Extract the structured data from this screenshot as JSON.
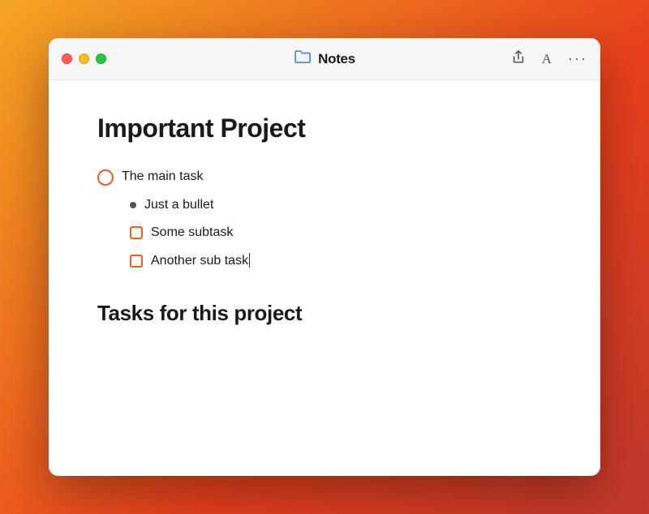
{
  "titlebar": {
    "title": "Notes",
    "traffic_lights": [
      "close",
      "minimize",
      "maximize"
    ],
    "actions": [
      "share",
      "font",
      "more"
    ]
  },
  "note": {
    "title": "Important Project",
    "items": [
      {
        "type": "circle-task",
        "text": "The main task",
        "indent": 0
      },
      {
        "type": "bullet",
        "text": "Just a bullet",
        "indent": 1
      },
      {
        "type": "checkbox",
        "text": "Some subtask",
        "indent": 1,
        "checked": false
      },
      {
        "type": "checkbox",
        "text": "Another sub task",
        "indent": 1,
        "checked": false,
        "has_cursor": true
      }
    ],
    "section_title": "Tasks for this project"
  }
}
